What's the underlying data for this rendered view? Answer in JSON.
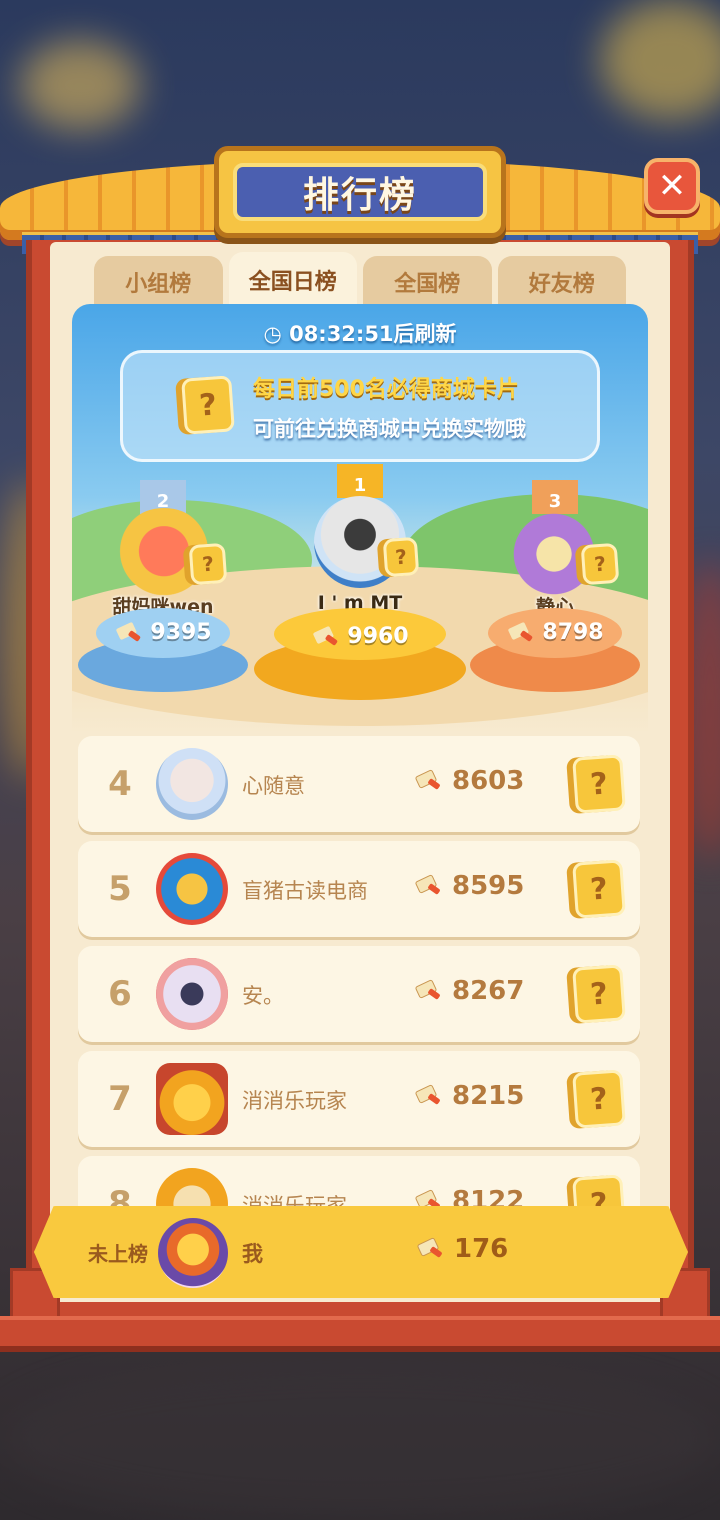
{
  "title": "排行榜",
  "close_label": "✕",
  "tabs": [
    {
      "label": "小组榜",
      "active": false
    },
    {
      "label": "全国日榜",
      "active": true
    },
    {
      "label": "全国榜",
      "active": false
    },
    {
      "label": "好友榜",
      "active": false
    }
  ],
  "timer": {
    "icon": "clock-icon",
    "text": "08:32:51后刷新"
  },
  "notice": {
    "line1": "每日前500名必得商城卡片",
    "line2": "可前往兑换商城中兑换实物哦"
  },
  "podium": [
    {
      "rank": "2",
      "name": "甜妈咪wen",
      "score": "9395"
    },
    {
      "rank": "1",
      "name": "I ' m MT",
      "score": "9960"
    },
    {
      "rank": "3",
      "name": "静心",
      "score": "8798"
    }
  ],
  "card_icon_text": "?",
  "rows": [
    {
      "rank": "4",
      "name": "心随意",
      "score": "8603"
    },
    {
      "rank": "5",
      "name": "盲猪古读电商",
      "score": "8595"
    },
    {
      "rank": "6",
      "name": "安。",
      "score": "8267"
    },
    {
      "rank": "7",
      "name": "消消乐玩家",
      "score": "8215"
    },
    {
      "rank": "8",
      "name": "消消乐玩家",
      "score": "8122"
    }
  ],
  "self": {
    "label": "未上榜",
    "name": "我",
    "score": "176"
  },
  "colors": {
    "gold": "#f9c93e",
    "frame_red": "#c94a31",
    "panel": "#f7ead0",
    "title_blue": "#4b5fb0"
  }
}
